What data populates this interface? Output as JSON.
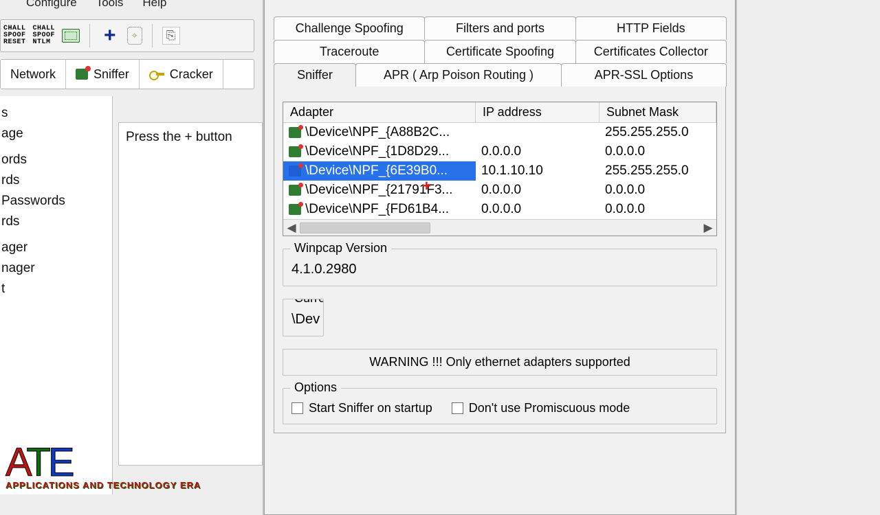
{
  "menu": {
    "configure": "Configure",
    "tools": "Tools",
    "help": "Help"
  },
  "toolbar": {
    "chall_spoof_reset": "CHALL\nSPOOF\nRESET",
    "chall_spoof_ntlm": "CHALL\nSPOOF\nNTLM"
  },
  "main_tabs": {
    "network": "Network",
    "sniffer": "Sniffer",
    "cracker": "Cracker"
  },
  "left_tree": {
    "items": [
      "s",
      "age",
      "",
      "ords",
      "rds",
      " Passwords",
      "rds",
      "",
      "ager",
      "nager",
      "t"
    ]
  },
  "hint": "Press the + button",
  "dialog": {
    "tabs_row1": [
      "Challenge Spoofing",
      "Filters and ports",
      "HTTP Fields"
    ],
    "tabs_row2": [
      "Traceroute",
      "Certificate Spoofing",
      "Certificates Collector"
    ],
    "tabs_row3": [
      "Sniffer",
      "APR ( Arp Poison Routing )",
      "APR-SSL Options"
    ],
    "list": {
      "headers": [
        "Adapter",
        "IP address",
        "Subnet Mask"
      ],
      "rows": [
        {
          "adapter": "\\Device\\NPF_{A88B2C...",
          "ip": "",
          "mask": "255.255.255.0",
          "selected": false
        },
        {
          "adapter": "\\Device\\NPF_{1D8D29...",
          "ip": "0.0.0.0",
          "mask": "0.0.0.0",
          "selected": false
        },
        {
          "adapter": "\\Device\\NPF_{6E39B0...",
          "ip": "10.1.10.10",
          "mask": "255.255.255.0",
          "selected": true
        },
        {
          "adapter": "\\Device\\NPF_{21791F3...",
          "ip": "0.0.0.0",
          "mask": "0.0.0.0",
          "selected": false
        },
        {
          "adapter": "\\Device\\NPF_{FD61B4...",
          "ip": "0.0.0.0",
          "mask": "0.0.0.0",
          "selected": false
        }
      ]
    },
    "winpcap": {
      "legend": "Winpcap Version",
      "value": "4.1.0.2980"
    },
    "current": {
      "legend": "Curre",
      "value": "\\Dev"
    },
    "warning": "WARNING !!! Only ethernet adapters supported",
    "options": {
      "legend": "Options",
      "start_sniffer": "Start Sniffer on startup",
      "no_promisc": "Don't use Promiscuous mode"
    }
  },
  "watermark": {
    "big_a": "A",
    "big_t": "T",
    "big_e": "E",
    "sub": "APPLICATIONS AND TECHNOLOGY ERA"
  }
}
